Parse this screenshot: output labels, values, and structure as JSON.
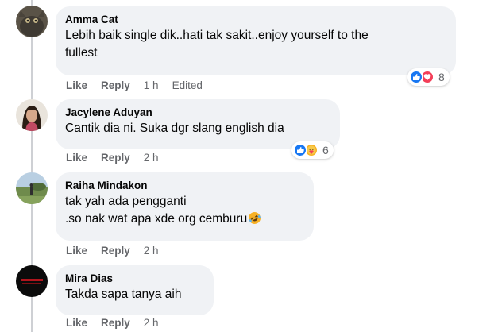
{
  "comments": [
    {
      "author": "Amma Cat",
      "lines": [
        "Lebih baik single dik..hati tak sakit..enjoy yourself to the",
        "fullest"
      ],
      "reactions": {
        "icons": [
          "like-icon",
          "love-icon"
        ],
        "count": "8"
      },
      "actions": {
        "like": "Like",
        "reply": "Reply",
        "time": "1 h",
        "edited": "Edited"
      }
    },
    {
      "author": "Jacylene Aduyan",
      "lines": [
        "Cantik dia ni. Suka dgr slang english dia"
      ],
      "reactions": {
        "icons": [
          "like-icon",
          "care-icon"
        ],
        "count": "6"
      },
      "actions": {
        "like": "Like",
        "reply": "Reply",
        "time": "2 h"
      }
    },
    {
      "author": "Raiha Mindakon",
      "lines": [
        "tak yah ada pengganti",
        ".so nak wat apa xde org cemburu"
      ],
      "inline_emoji": "rolling-laughing-emoji",
      "actions": {
        "like": "Like",
        "reply": "Reply",
        "time": "2 h"
      }
    },
    {
      "author": "Mira Dias",
      "lines": [
        "Takda sapa tanya aih"
      ],
      "actions": {
        "like": "Like",
        "reply": "Reply",
        "time": "2 h"
      }
    }
  ],
  "colors": {
    "bubble": "#f0f2f5",
    "secondary_text": "#65676b",
    "like_blue": "#1877f2",
    "love_red": "#f33e58",
    "emoji_yellow": "#f7b125"
  }
}
